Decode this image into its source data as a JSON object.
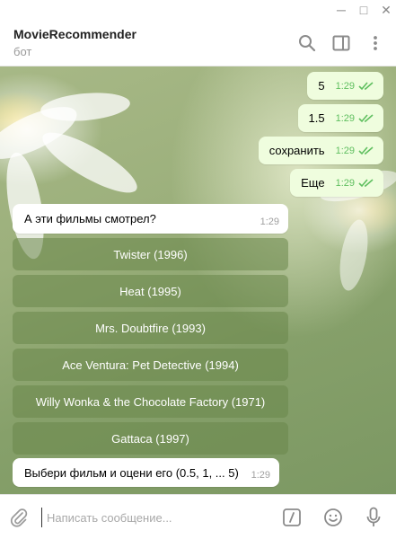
{
  "window": {
    "min_glyph": "─",
    "max_glyph": "□",
    "close_glyph": "✕"
  },
  "header": {
    "title": "MovieRecommender",
    "subtitle": "бот"
  },
  "outgoing": [
    {
      "text": "5",
      "time": "1:29"
    },
    {
      "text": "1.5",
      "time": "1:29"
    },
    {
      "text": "сохранить",
      "time": "1:29"
    },
    {
      "text": "Еще",
      "time": "1:29"
    }
  ],
  "question": {
    "text": "А эти фильмы смотрел?",
    "time": "1:29"
  },
  "movie_buttons": [
    "Twister (1996)",
    "Heat (1995)",
    "Mrs. Doubtfire (1993)",
    "Ace Ventura: Pet Detective (1994)",
    "Willy Wonka & the Chocolate Factory (1971)",
    "Gattaca (1997)"
  ],
  "prompt": {
    "text": "Выбери фильм и оцени его (0.5, 1, ... 5)",
    "time": "1:29"
  },
  "composer": {
    "placeholder": "Написать сообщение..."
  },
  "icons": [
    "search-icon",
    "sidebar-toggle-icon",
    "more-vertical-icon",
    "attach-icon",
    "bot-commands-icon",
    "emoji-icon",
    "microphone-icon"
  ],
  "colors": {
    "outgoing_bubble": "#effdde",
    "read_ticks": "#5fbf5f",
    "inline_button": "#6a8a4b"
  }
}
